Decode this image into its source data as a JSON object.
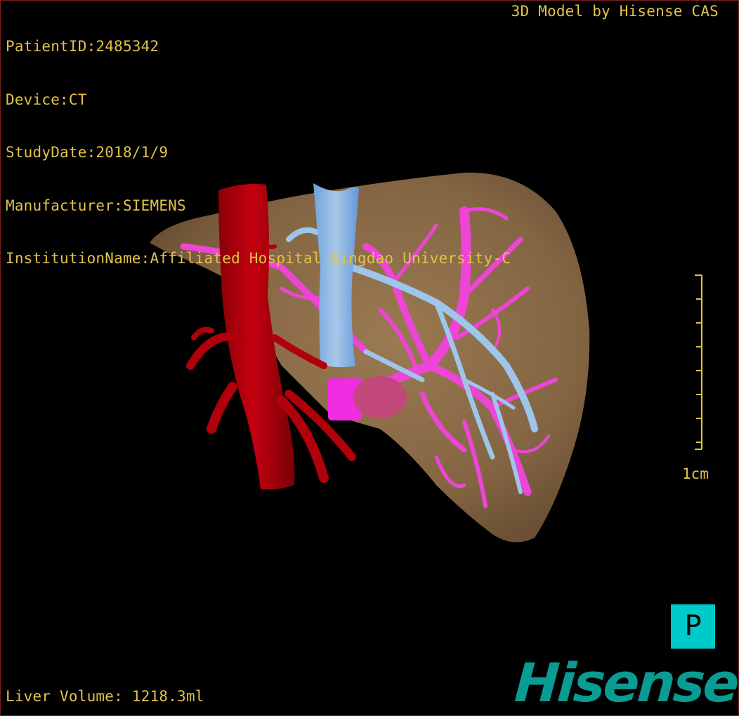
{
  "header": {
    "patient_id": "PatientID:2485342",
    "device": "Device:CT",
    "study_date": "StudyDate:2018/1/9",
    "manufacturer": "Manufacturer:SIEMENS",
    "institution": "InstitutionName:Affiliated Hospital Qingdao University-C"
  },
  "credit": "3D Model by Hisense CAS",
  "scale_label": "1cm",
  "view_badge": "P",
  "liver_volume": "Liver Volume: 1218.3ml",
  "brand": "Hisense",
  "colors": {
    "overlay_text": "#e2c24a",
    "liver": "#8a6a44",
    "artery_red": "#b0000c",
    "portal_vein_magenta": "#ee44d8",
    "hepatic_vein_blue": "#9ec5ea",
    "badge_cyan": "#00c9c9",
    "brand_teal": "#0a9b92",
    "frame": "#7a1f1f"
  },
  "icons": {
    "view_badge": "posterior-view-icon"
  }
}
